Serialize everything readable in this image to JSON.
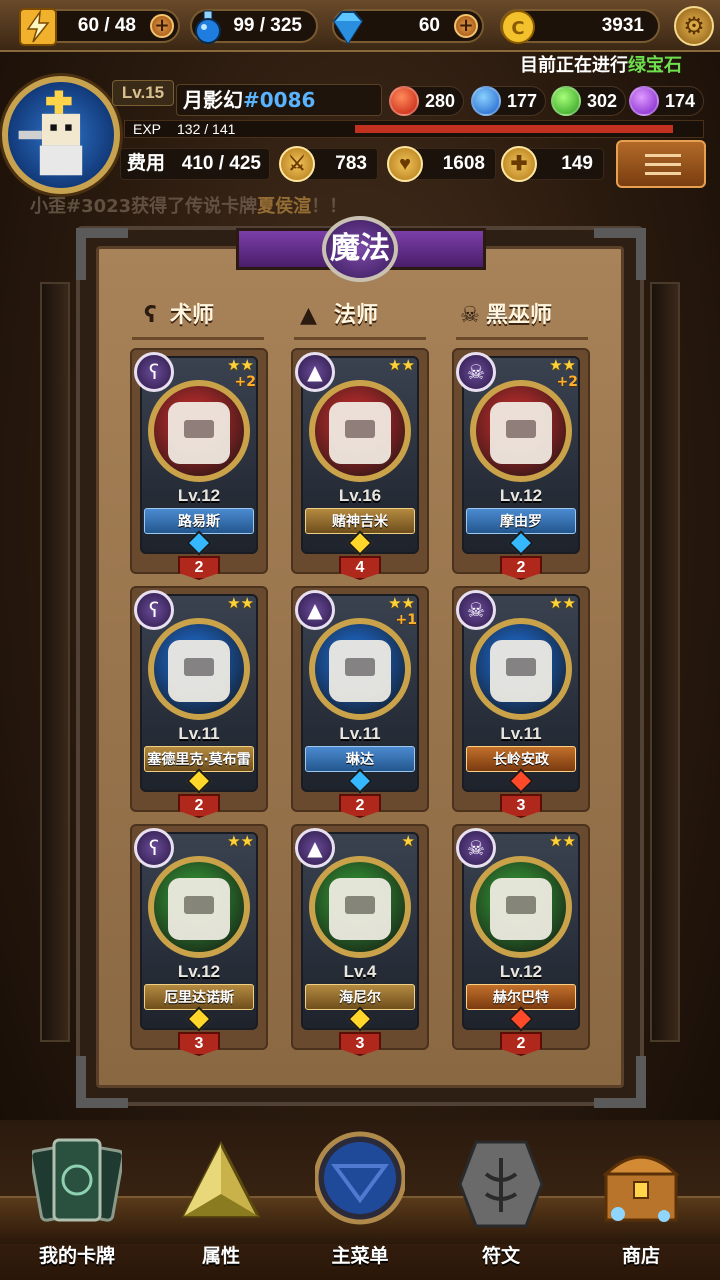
{
  "resources": {
    "energy": "60 / 48",
    "potion": "99 / 325",
    "diamond": "60",
    "gold": "3931"
  },
  "ticker": {
    "prefix": "目前正在进行",
    "highlight": "绿宝石"
  },
  "player": {
    "level": "Lv.15",
    "name": "月影幻",
    "tag": "#0086",
    "exp_label": "EXP",
    "exp_value": "132 / 141",
    "exp_fraction": 0.936,
    "gems": {
      "red": "280",
      "blue": "177",
      "green": "302",
      "purple": "174"
    },
    "cost_label": "费用",
    "cost_value": "410 / 425",
    "attack": "783",
    "health": "1608",
    "heal": "149"
  },
  "announcement": {
    "prefix": "小歪#3023获得了传说卡牌",
    "highlight": "夏侯渲",
    "suffix": "！！"
  },
  "panel": {
    "title": "魔法",
    "columns": [
      "术师",
      "法师",
      "黑巫师"
    ]
  },
  "cards": [
    {
      "name": "路易斯",
      "level": "Lv.12",
      "stars": "★★",
      "plus": "+2",
      "count": "2",
      "ribbon": "blue",
      "orb": "#a02828",
      "cls": "warlock"
    },
    {
      "name": "赌神吉米",
      "level": "Lv.16",
      "stars": "★★",
      "plus": "",
      "count": "4",
      "ribbon": "gold",
      "orb": "#a02828",
      "cls": "mage"
    },
    {
      "name": "摩由罗",
      "level": "Lv.12",
      "stars": "★★",
      "plus": "+2",
      "count": "2",
      "ribbon": "blue",
      "orb": "#a02828",
      "cls": "necro"
    },
    {
      "name": "塞德里克·莫布雷",
      "level": "Lv.11",
      "stars": "★★",
      "plus": "",
      "count": "2",
      "ribbon": "gold",
      "orb": "#1c58a8",
      "cls": "warlock"
    },
    {
      "name": "琳达",
      "level": "Lv.11",
      "stars": "★★",
      "plus": "+1",
      "count": "2",
      "ribbon": "blue",
      "orb": "#1c58a8",
      "cls": "mage"
    },
    {
      "name": "长岭安政",
      "level": "Lv.11",
      "stars": "★★",
      "plus": "",
      "count": "3",
      "ribbon": "wreath",
      "orb": "#1c58a8",
      "cls": "necro"
    },
    {
      "name": "厄里达诺斯",
      "level": "Lv.12",
      "stars": "★★",
      "plus": "",
      "count": "3",
      "ribbon": "gold",
      "orb": "#2e7a2e",
      "cls": "warlock"
    },
    {
      "name": "海尼尔",
      "level": "Lv.4",
      "stars": "★",
      "plus": "",
      "count": "3",
      "ribbon": "gold",
      "orb": "#2e7a2e",
      "cls": "mage"
    },
    {
      "name": "赫尔巴特",
      "level": "Lv.12",
      "stars": "★★",
      "plus": "",
      "count": "2",
      "ribbon": "wreath",
      "orb": "#2e7a2e",
      "cls": "necro"
    }
  ],
  "nav": [
    {
      "label": "我的卡牌",
      "icon": "cards-icon"
    },
    {
      "label": "属性",
      "icon": "triangle-crystal-icon"
    },
    {
      "label": "主菜单",
      "icon": "main-emblem-icon"
    },
    {
      "label": "符文",
      "icon": "rune-stone-icon"
    },
    {
      "label": "商店",
      "icon": "treasure-chest-icon"
    }
  ],
  "colors": {
    "orb_red": "#a02828",
    "orb_blue": "#1c58a8",
    "orb_green": "#2e7a2e",
    "title_purple": "#7b3ea8"
  }
}
